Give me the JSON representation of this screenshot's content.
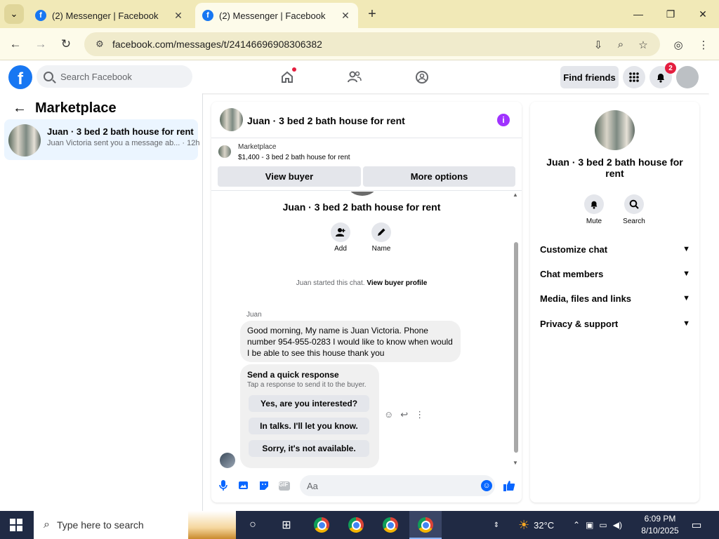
{
  "browser": {
    "tabs": [
      {
        "label": "(2) Messenger | Facebook",
        "active": false
      },
      {
        "label": "(2) Messenger | Facebook",
        "active": true
      }
    ],
    "url": "facebook.com/messages/t/24146696908306382"
  },
  "fb_header": {
    "search_placeholder": "Search Facebook",
    "find_friends": "Find friends",
    "notification_count": "2"
  },
  "left_panel": {
    "title": "Marketplace",
    "conversations": [
      {
        "title": "Juan · 3 bed 2 bath house for rent",
        "preview": "Juan Victoria sent you a message ab...",
        "time": "· 12h"
      }
    ]
  },
  "chat": {
    "title": "Juan · 3 bed 2 bath house for rent",
    "listing": {
      "category": "Marketplace",
      "detail": "$1,400 - 3 bed 2 bath house for rent"
    },
    "buttons": {
      "view_buyer": "View buyer",
      "more_options": "More options"
    },
    "thread_title": "Juan · 3 bed 2 bath house for rent",
    "actions": {
      "add": "Add",
      "name": "Name"
    },
    "started_text": "Juan started this chat.",
    "view_buyer_profile": "View buyer profile",
    "sender": "Juan",
    "message": "Good morning, My name is Juan Victoria. Phone number 954-955-0283 I would like to know when would I be able to see this house thank you",
    "quick_response": {
      "heading": "Send a quick response",
      "subtitle": "Tap a response to send it to the buyer.",
      "options": [
        "Yes, are you interested?",
        "In talks. I'll let you know.",
        "Sorry, it's not available."
      ]
    },
    "composer_placeholder": "Aa",
    "gif_label": "GIF"
  },
  "right_panel": {
    "title": "Juan · 3 bed 2 bath house for rent",
    "actions": {
      "mute": "Mute",
      "search": "Search"
    },
    "sections": [
      "Customize chat",
      "Chat members",
      "Media, files and links",
      "Privacy & support"
    ]
  },
  "taskbar": {
    "search_placeholder": "Type here to search",
    "weather": "32°C",
    "time": "6:09 PM",
    "date": "8/10/2025"
  },
  "colors": {
    "facebook_blue": "#1877f2",
    "messenger_blue": "#0866ff",
    "info_purple": "#a033ff",
    "selected_conv": "#ebf5ff"
  }
}
